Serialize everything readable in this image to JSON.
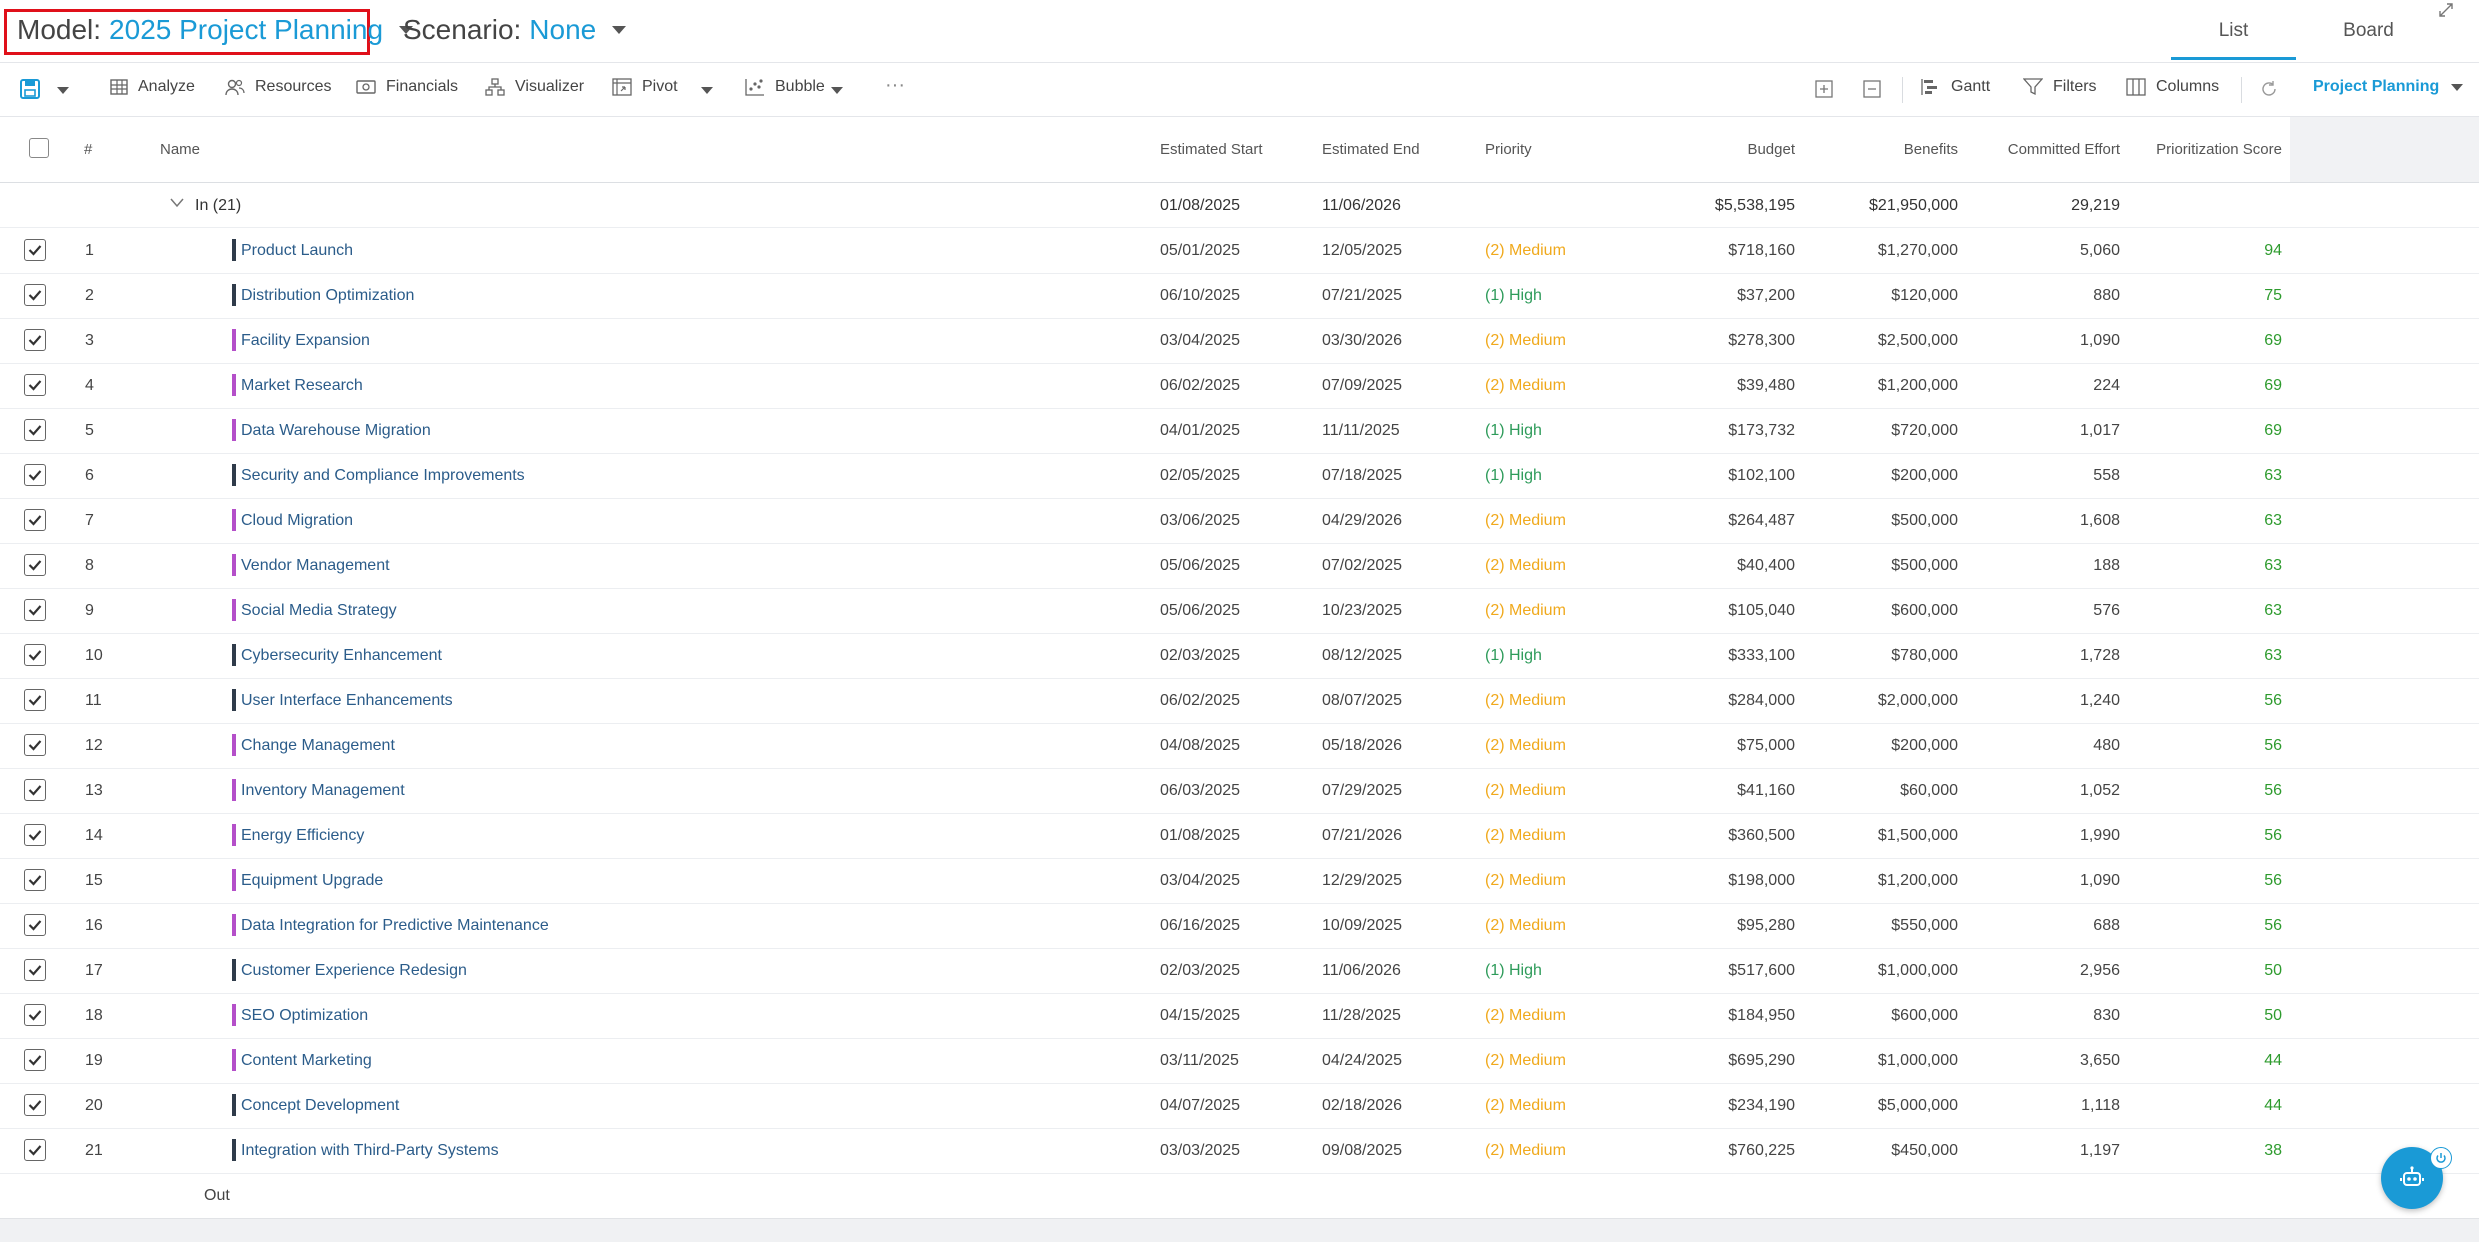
{
  "header": {
    "model_label": "Model:",
    "model_value": "2025 Project Planning",
    "scenario_label": "Scenario:",
    "scenario_value": "None",
    "tabs": [
      {
        "label": "List",
        "active": true
      },
      {
        "label": "Board",
        "active": false
      }
    ]
  },
  "toolbar": {
    "analyze": "Analyze",
    "resources": "Resources",
    "financials": "Financials",
    "visualizer": "Visualizer",
    "pivot": "Pivot",
    "bubble": "Bubble",
    "more": "···",
    "gantt": "Gantt",
    "filters": "Filters",
    "columns": "Columns",
    "view_select": "Project Planning"
  },
  "columns": {
    "index": "#",
    "name": "Name",
    "estimated_start": "Estimated Start",
    "estimated_end": "Estimated End",
    "priority": "Priority",
    "budget": "Budget",
    "benefits": "Benefits",
    "committed_effort": "Committed Effort",
    "prioritization_score": "Prioritization Score"
  },
  "group_in": {
    "label": "In (21)",
    "estimated_start": "01/08/2025",
    "estimated_end": "11/06/2026",
    "budget": "$5,538,195",
    "benefits": "$21,950,000",
    "committed_effort": "29,219"
  },
  "group_out": {
    "label": "Out"
  },
  "colors": {
    "accent": "#1a9ad6",
    "bar_dark": "#2f3b4a",
    "bar_purple": "#b44fc9",
    "priority_medium": "#f0a91c",
    "priority_high": "#2e9b5a",
    "score": "#2e9b2e",
    "highlight_box": "#e0101a"
  },
  "rows": [
    {
      "n": "1",
      "name": "Product Launch",
      "start": "05/01/2025",
      "end": "12/05/2025",
      "priority": "(2) Medium",
      "level": "medium",
      "budget": "$718,160",
      "benefits": "$1,270,000",
      "effort": "5,060",
      "score": "94",
      "bar": "dark",
      "checked": true
    },
    {
      "n": "2",
      "name": "Distribution Optimization",
      "start": "06/10/2025",
      "end": "07/21/2025",
      "priority": "(1) High",
      "level": "high",
      "budget": "$37,200",
      "benefits": "$120,000",
      "effort": "880",
      "score": "75",
      "bar": "dark",
      "checked": true
    },
    {
      "n": "3",
      "name": "Facility Expansion",
      "start": "03/04/2025",
      "end": "03/30/2026",
      "priority": "(2) Medium",
      "level": "medium",
      "budget": "$278,300",
      "benefits": "$2,500,000",
      "effort": "1,090",
      "score": "69",
      "bar": "purple",
      "checked": true
    },
    {
      "n": "4",
      "name": "Market Research",
      "start": "06/02/2025",
      "end": "07/09/2025",
      "priority": "(2) Medium",
      "level": "medium",
      "budget": "$39,480",
      "benefits": "$1,200,000",
      "effort": "224",
      "score": "69",
      "bar": "purple",
      "checked": true
    },
    {
      "n": "5",
      "name": "Data Warehouse Migration",
      "start": "04/01/2025",
      "end": "11/11/2025",
      "priority": "(1) High",
      "level": "high",
      "budget": "$173,732",
      "benefits": "$720,000",
      "effort": "1,017",
      "score": "69",
      "bar": "purple",
      "checked": true
    },
    {
      "n": "6",
      "name": "Security and Compliance Improvements",
      "start": "02/05/2025",
      "end": "07/18/2025",
      "priority": "(1) High",
      "level": "high",
      "budget": "$102,100",
      "benefits": "$200,000",
      "effort": "558",
      "score": "63",
      "bar": "dark",
      "checked": true
    },
    {
      "n": "7",
      "name": "Cloud Migration",
      "start": "03/06/2025",
      "end": "04/29/2026",
      "priority": "(2) Medium",
      "level": "medium",
      "budget": "$264,487",
      "benefits": "$500,000",
      "effort": "1,608",
      "score": "63",
      "bar": "purple",
      "checked": true
    },
    {
      "n": "8",
      "name": "Vendor Management",
      "start": "05/06/2025",
      "end": "07/02/2025",
      "priority": "(2) Medium",
      "level": "medium",
      "budget": "$40,400",
      "benefits": "$500,000",
      "effort": "188",
      "score": "63",
      "bar": "purple",
      "checked": true
    },
    {
      "n": "9",
      "name": "Social Media Strategy",
      "start": "05/06/2025",
      "end": "10/23/2025",
      "priority": "(2) Medium",
      "level": "medium",
      "budget": "$105,040",
      "benefits": "$600,000",
      "effort": "576",
      "score": "63",
      "bar": "purple",
      "checked": true
    },
    {
      "n": "10",
      "name": "Cybersecurity Enhancement",
      "start": "02/03/2025",
      "end": "08/12/2025",
      "priority": "(1) High",
      "level": "high",
      "budget": "$333,100",
      "benefits": "$780,000",
      "effort": "1,728",
      "score": "63",
      "bar": "dark",
      "checked": true
    },
    {
      "n": "11",
      "name": "User Interface Enhancements",
      "start": "06/02/2025",
      "end": "08/07/2025",
      "priority": "(2) Medium",
      "level": "medium",
      "budget": "$284,000",
      "benefits": "$2,000,000",
      "effort": "1,240",
      "score": "56",
      "bar": "dark",
      "checked": true
    },
    {
      "n": "12",
      "name": "Change Management",
      "start": "04/08/2025",
      "end": "05/18/2026",
      "priority": "(2) Medium",
      "level": "medium",
      "budget": "$75,000",
      "benefits": "$200,000",
      "effort": "480",
      "score": "56",
      "bar": "purple",
      "checked": true
    },
    {
      "n": "13",
      "name": "Inventory Management",
      "start": "06/03/2025",
      "end": "07/29/2025",
      "priority": "(2) Medium",
      "level": "medium",
      "budget": "$41,160",
      "benefits": "$60,000",
      "effort": "1,052",
      "score": "56",
      "bar": "purple",
      "checked": true
    },
    {
      "n": "14",
      "name": "Energy Efficiency",
      "start": "01/08/2025",
      "end": "07/21/2026",
      "priority": "(2) Medium",
      "level": "medium",
      "budget": "$360,500",
      "benefits": "$1,500,000",
      "effort": "1,990",
      "score": "56",
      "bar": "purple",
      "checked": true
    },
    {
      "n": "15",
      "name": "Equipment Upgrade",
      "start": "03/04/2025",
      "end": "12/29/2025",
      "priority": "(2) Medium",
      "level": "medium",
      "budget": "$198,000",
      "benefits": "$1,200,000",
      "effort": "1,090",
      "score": "56",
      "bar": "purple",
      "checked": true
    },
    {
      "n": "16",
      "name": "Data Integration for Predictive Maintenance",
      "start": "06/16/2025",
      "end": "10/09/2025",
      "priority": "(2) Medium",
      "level": "medium",
      "budget": "$95,280",
      "benefits": "$550,000",
      "effort": "688",
      "score": "56",
      "bar": "purple",
      "checked": true
    },
    {
      "n": "17",
      "name": "Customer Experience Redesign",
      "start": "02/03/2025",
      "end": "11/06/2026",
      "priority": "(1) High",
      "level": "high",
      "budget": "$517,600",
      "benefits": "$1,000,000",
      "effort": "2,956",
      "score": "50",
      "bar": "dark",
      "checked": true
    },
    {
      "n": "18",
      "name": "SEO Optimization",
      "start": "04/15/2025",
      "end": "11/28/2025",
      "priority": "(2) Medium",
      "level": "medium",
      "budget": "$184,950",
      "benefits": "$600,000",
      "effort": "830",
      "score": "50",
      "bar": "purple",
      "checked": true
    },
    {
      "n": "19",
      "name": "Content Marketing",
      "start": "03/11/2025",
      "end": "04/24/2025",
      "priority": "(2) Medium",
      "level": "medium",
      "budget": "$695,290",
      "benefits": "$1,000,000",
      "effort": "3,650",
      "score": "44",
      "bar": "purple",
      "checked": true
    },
    {
      "n": "20",
      "name": "Concept Development",
      "start": "04/07/2025",
      "end": "02/18/2026",
      "priority": "(2) Medium",
      "level": "medium",
      "budget": "$234,190",
      "benefits": "$5,000,000",
      "effort": "1,118",
      "score": "44",
      "bar": "dark",
      "checked": true
    },
    {
      "n": "21",
      "name": "Integration with Third-Party Systems",
      "start": "03/03/2025",
      "end": "09/08/2025",
      "priority": "(2) Medium",
      "level": "medium",
      "budget": "$760,225",
      "benefits": "$450,000",
      "effort": "1,197",
      "score": "38",
      "bar": "dark",
      "checked": true
    }
  ]
}
